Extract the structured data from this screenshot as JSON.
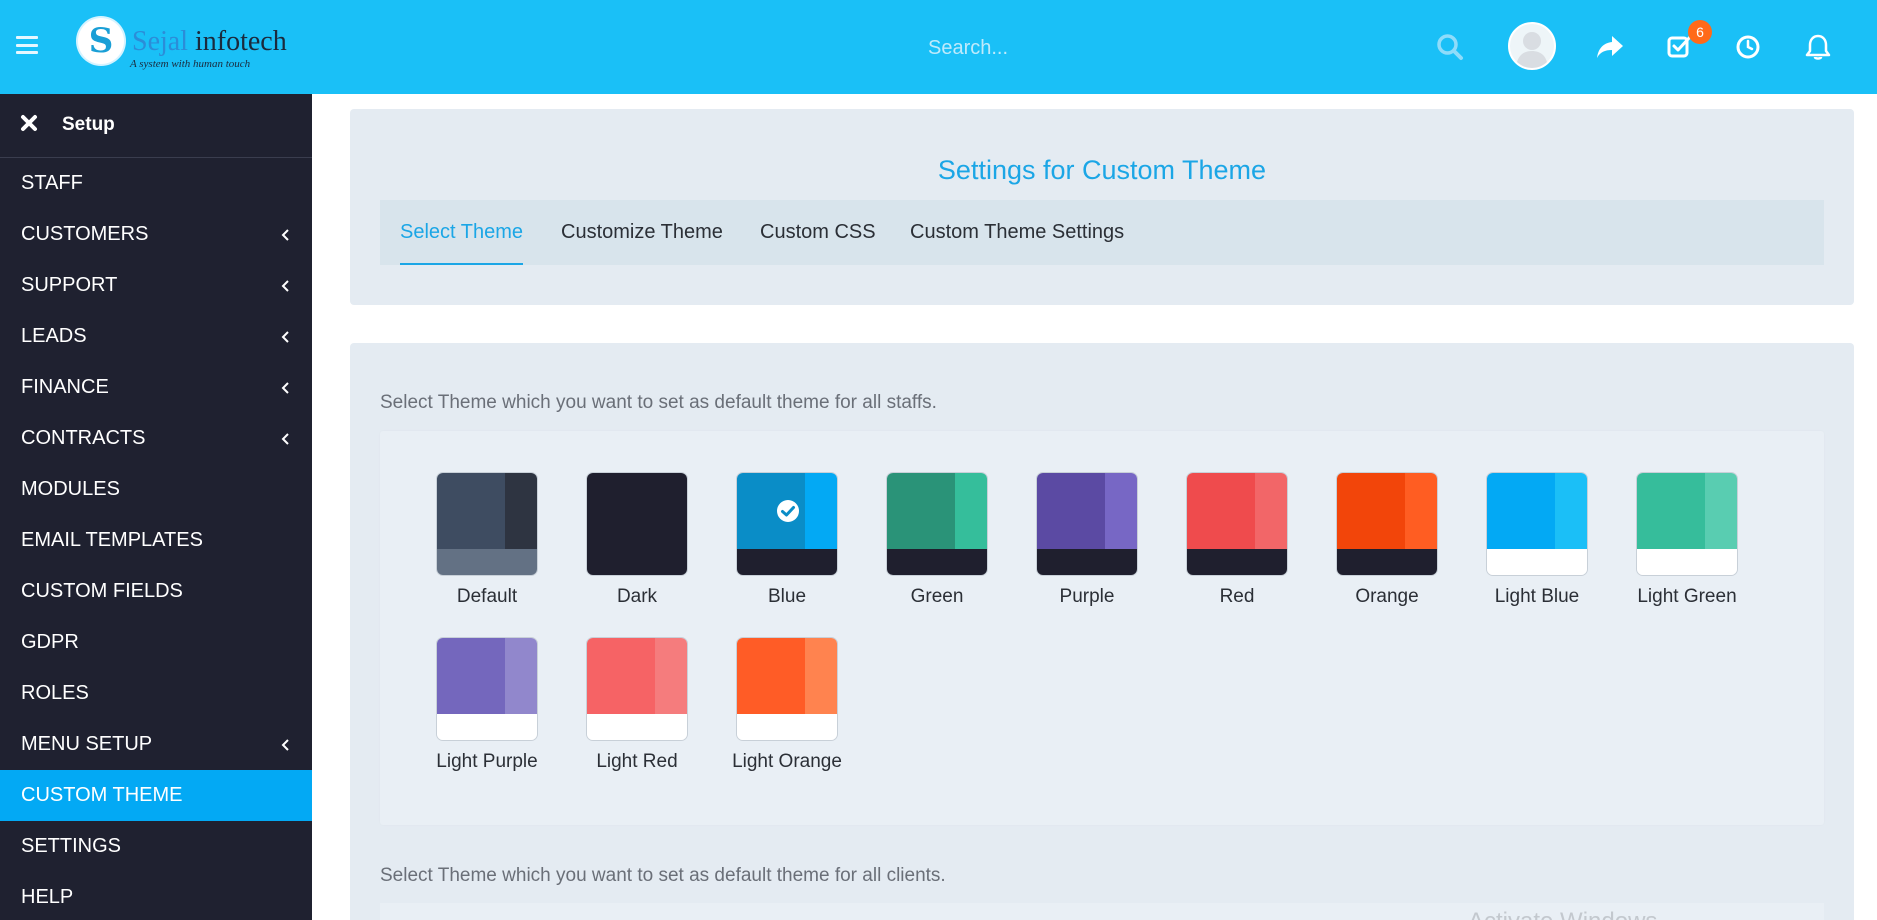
{
  "header": {
    "brand_name_part1": "Sejal",
    "brand_name_part2": " infotech",
    "brand_logo_letter": "S",
    "brand_tagline": "A system with human touch",
    "search_placeholder": "Search...",
    "tasks_badge_count": "6",
    "icons": [
      "hamburger-menu-icon",
      "search-icon",
      "user-avatar",
      "share-icon",
      "tasks-icon",
      "clock-icon",
      "bell-icon"
    ]
  },
  "sidebar": {
    "setup_label": "Setup",
    "items": [
      {
        "label": "STAFF",
        "has_submenu": false,
        "active": false
      },
      {
        "label": "CUSTOMERS",
        "has_submenu": true,
        "active": false
      },
      {
        "label": "SUPPORT",
        "has_submenu": true,
        "active": false
      },
      {
        "label": "LEADS",
        "has_submenu": true,
        "active": false
      },
      {
        "label": "FINANCE",
        "has_submenu": true,
        "active": false
      },
      {
        "label": "CONTRACTS",
        "has_submenu": true,
        "active": false
      },
      {
        "label": "MODULES",
        "has_submenu": false,
        "active": false
      },
      {
        "label": "EMAIL TEMPLATES",
        "has_submenu": false,
        "active": false
      },
      {
        "label": "CUSTOM FIELDS",
        "has_submenu": false,
        "active": false
      },
      {
        "label": "GDPR",
        "has_submenu": false,
        "active": false
      },
      {
        "label": "ROLES",
        "has_submenu": false,
        "active": false
      },
      {
        "label": "MENU SETUP",
        "has_submenu": true,
        "active": false
      },
      {
        "label": "CUSTOM THEME",
        "has_submenu": false,
        "active": true
      },
      {
        "label": "SETTINGS",
        "has_submenu": false,
        "active": false
      },
      {
        "label": "HELP",
        "has_submenu": false,
        "active": false
      }
    ]
  },
  "main": {
    "title": "Settings for Custom Theme",
    "tabs": [
      {
        "label": "Select Theme",
        "active": true
      },
      {
        "label": "Customize Theme",
        "active": false
      },
      {
        "label": "Custom CSS",
        "active": false
      },
      {
        "label": "Custom Theme Settings",
        "active": false
      }
    ],
    "staff_section_text": "Select Theme which you want to set as default theme for all staffs.",
    "clients_section_text": "Select Theme which you want to set as default theme for all clients.",
    "selected_theme": "Blue",
    "themes": [
      {
        "label": "Default",
        "colors": [
          "#3e4c61",
          "#2e3441",
          "#637184"
        ],
        "selected": false
      },
      {
        "label": "Dark",
        "colors": [
          "#1f1f2e",
          "#1f1f2e",
          "#1f1f2e"
        ],
        "selected": false
      },
      {
        "label": "Blue",
        "colors": [
          "#0a8dc7",
          "#03a9f4",
          "#1f1f2e"
        ],
        "selected": true
      },
      {
        "label": "Green",
        "colors": [
          "#2a9378",
          "#35be9b",
          "#1f1f2e"
        ],
        "selected": false
      },
      {
        "label": "Purple",
        "colors": [
          "#5b4aa3",
          "#7767c5",
          "#1f1f2e"
        ],
        "selected": false
      },
      {
        "label": "Red",
        "colors": [
          "#ef4b4d",
          "#f26668",
          "#1f1f2e"
        ],
        "selected": false
      },
      {
        "label": "Orange",
        "colors": [
          "#f2450a",
          "#ff5d22",
          "#1f1f2e"
        ],
        "selected": false
      },
      {
        "label": "Light Blue",
        "colors": [
          "#03a9f4",
          "#1bbff7",
          "#ffffff"
        ],
        "selected": false
      },
      {
        "label": "Light Green",
        "colors": [
          "#36bd9b",
          "#59cdb1",
          "#ffffff"
        ],
        "selected": false
      },
      {
        "label": "Light Purple",
        "colors": [
          "#7467bd",
          "#9187cc",
          "#ffffff"
        ],
        "selected": false
      },
      {
        "label": "Light Red",
        "colors": [
          "#f66365",
          "#f57c7d",
          "#ffffff"
        ],
        "selected": false
      },
      {
        "label": "Light Orange",
        "colors": [
          "#ff5c26",
          "#ff834f",
          "#ffffff"
        ],
        "selected": false
      }
    ]
  },
  "watermark_text": "Activate Windows",
  "colors": {
    "header_bg": "#1ac0f7",
    "sidebar_bg": "#1f2130",
    "sidebar_active": "#03a9f4",
    "accent": "#1ba6e6",
    "panel_bg": "#e4ebf2",
    "badge": "#ff6a1a"
  }
}
